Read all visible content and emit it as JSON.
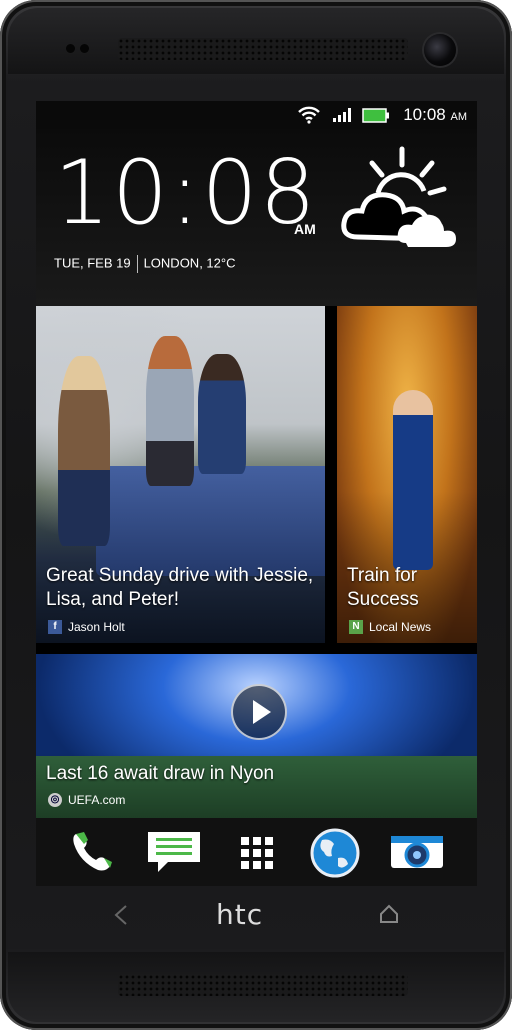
{
  "status_bar": {
    "time": "10:08",
    "ampm": "AM"
  },
  "clock_widget": {
    "time": "10:08",
    "ampm": "AM",
    "date": "TUE, FEB 19",
    "location_temp": "LONDON, 12°C",
    "weather_icon": "partly-cloudy-icon"
  },
  "feed": {
    "tile1": {
      "title": "Great Sunday drive with Jessie, Lisa, and Peter!",
      "source": "Jason Holt",
      "source_icon": "facebook-icon"
    },
    "tile2": {
      "title": "Train for Success",
      "source": "Local News",
      "source_icon": "local-news-icon"
    },
    "tile3": {
      "title": "Last 16 await draw in Nyon",
      "source": "UEFA.com",
      "source_icon": "uefa-icon"
    }
  },
  "dock": {
    "items": [
      "phone-icon",
      "messages-icon",
      "all-apps-icon",
      "browser-globe-icon",
      "camera-icon"
    ]
  },
  "hardware": {
    "logo": "htc",
    "back": "back-icon",
    "home": "home-icon"
  },
  "colors": {
    "accent_green": "#4cb848",
    "battery_green": "#3fbf3f"
  }
}
